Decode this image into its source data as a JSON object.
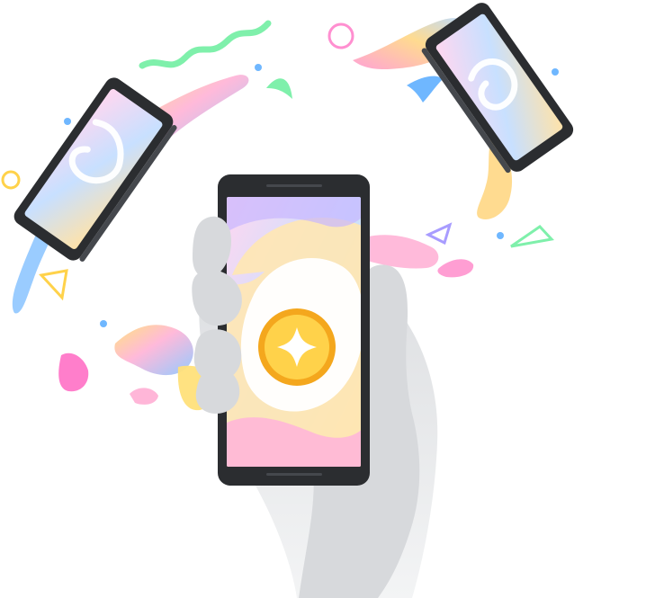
{
  "illustration": {
    "subject": "hand-holding-phone-with-coin",
    "colors": {
      "phone_body": "#2b2d30",
      "phone_bezel_detail": "#45484d",
      "hand": "#d7d9dc",
      "hand_shadow": "#e9eaec",
      "coin_outer": "#f4a71d",
      "coin_inner": "#ffd24a",
      "coin_star": "#ffffff",
      "splash_pink": "#ff9ed3",
      "splash_yellow": "#ffe07a",
      "splash_blue": "#8fc7ff",
      "splash_purple": "#c8b7ff",
      "confetti_green": "#7ff0ab",
      "confetti_blue": "#6fb7ff",
      "confetti_yellow": "#ffd75f",
      "confetti_pink": "#ff7ecb"
    }
  }
}
